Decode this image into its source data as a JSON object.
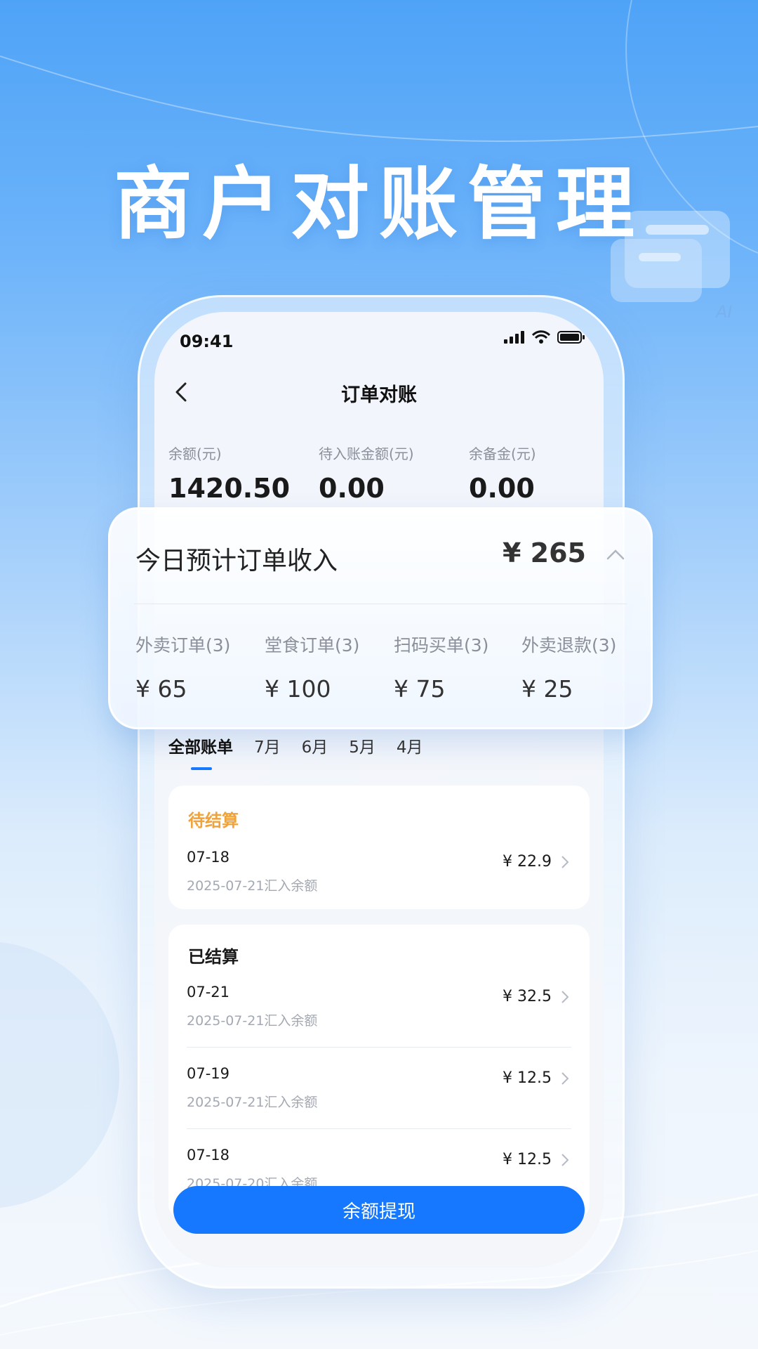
{
  "hero": {
    "title": "商户对账管理"
  },
  "status_bar": {
    "time": "09:41"
  },
  "nav": {
    "title": "订单对账"
  },
  "balances": [
    {
      "label": "余额(元)",
      "value": "1420.50"
    },
    {
      "label": "待入账金额(元)",
      "value": "0.00"
    },
    {
      "label": "余备金(元)",
      "value": "0.00"
    }
  ],
  "income": {
    "title": "今日预计订单收入",
    "total": "¥ 265",
    "items": [
      {
        "label": "外卖订单(3)",
        "value": "¥ 65"
      },
      {
        "label": "堂食订单(3)",
        "value": "¥ 100"
      },
      {
        "label": "扫码买单(3)",
        "value": "¥ 75"
      },
      {
        "label": "外卖退款(3)",
        "value": "¥ 25"
      }
    ]
  },
  "tabs": [
    "全部账单",
    "7月",
    "6月",
    "5月",
    "4月"
  ],
  "pending": {
    "heading": "待结算",
    "rows": [
      {
        "date": "07-18",
        "sub": "2025-07-21汇入余额",
        "amount": "¥ 22.9"
      }
    ]
  },
  "settled": {
    "heading": "已结算",
    "rows": [
      {
        "date": "07-21",
        "sub": "2025-07-21汇入余额",
        "amount": "¥ 32.5"
      },
      {
        "date": "07-19",
        "sub": "2025-07-21汇入余额",
        "amount": "¥ 12.5"
      },
      {
        "date": "07-18",
        "sub": "2025-07-20汇入余额",
        "amount": "¥ 12.5"
      }
    ]
  },
  "withdraw_button": "余额提现",
  "colors": {
    "primary": "#1677ff",
    "pending": "#f0a23b",
    "heading": "#1a1a1a"
  }
}
